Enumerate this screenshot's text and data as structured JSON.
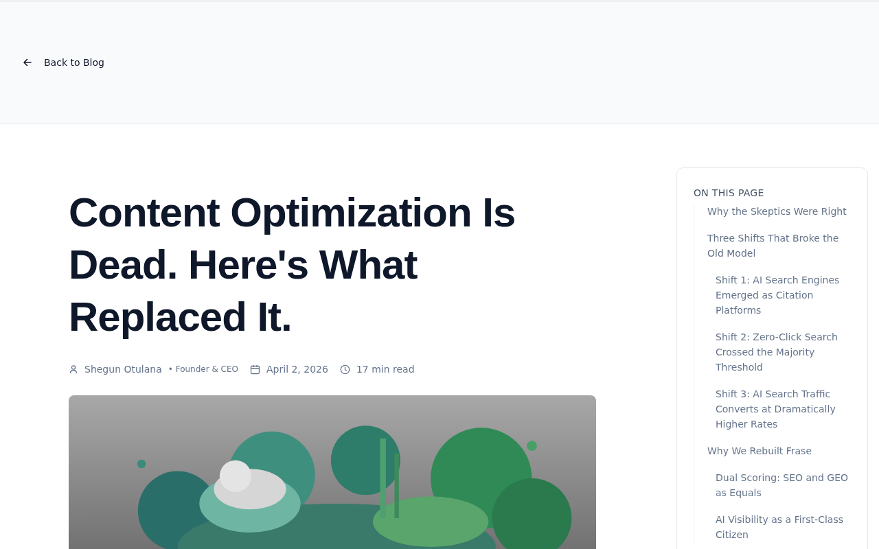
{
  "header": {
    "back_link": "Back to Blog"
  },
  "article": {
    "title": "Content Optimization Is Dead. Here's What Replaced It.",
    "meta": {
      "author": "Shegun Otulana",
      "role": "• Founder & CEO",
      "date": "April 2, 2026",
      "read_time": "17 min read"
    }
  },
  "toc": {
    "heading": "ON THIS PAGE",
    "items": [
      {
        "label": "Why the Skeptics Were Right"
      },
      {
        "label": "Three Shifts That Broke the Old Model",
        "children": [
          {
            "label": "Shift 1: AI Search Engines Emerged as Citation Platforms"
          },
          {
            "label": "Shift 2: Zero-Click Search Crossed the Majority Threshold"
          },
          {
            "label": "Shift 3: AI Search Traffic Converts at Dramatically Higher Rates"
          }
        ]
      },
      {
        "label": "Why We Rebuilt Frase",
        "children": [
          {
            "label": "Dual Scoring: SEO and GEO as Equals"
          },
          {
            "label": "AI Visibility as a First-Class Citizen"
          }
        ]
      }
    ]
  }
}
